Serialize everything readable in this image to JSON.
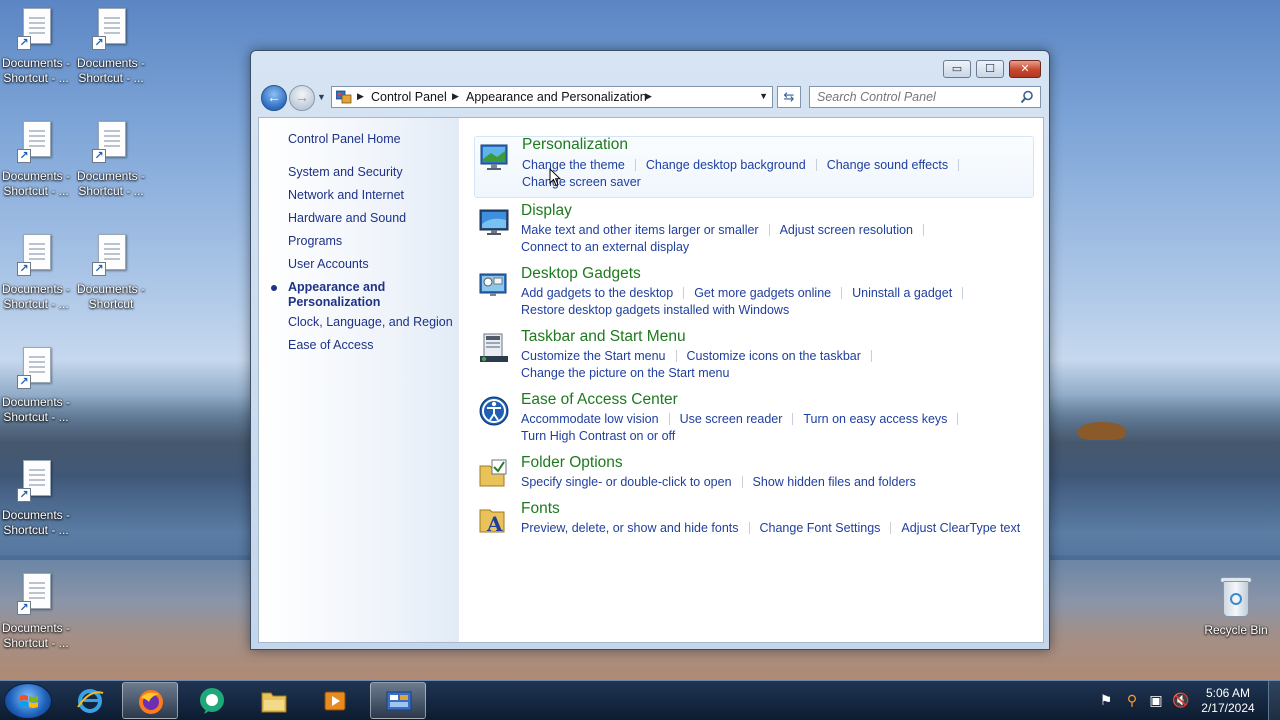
{
  "desktop": {
    "icons": [
      {
        "line1": "Documents -",
        "line2": "Shortcut - ..."
      },
      {
        "line1": "Documents -",
        "line2": "Shortcut - ..."
      },
      {
        "line1": "Documents -",
        "line2": "Shortcut - ..."
      },
      {
        "line1": "Documents -",
        "line2": "Shortcut - ..."
      },
      {
        "line1": "Documents -",
        "line2": "Shortcut - ..."
      },
      {
        "line1": "Documents -",
        "line2": "Shortcut"
      },
      {
        "line1": "Documents -",
        "line2": "Shortcut - ..."
      },
      {
        "line1": "Documents -",
        "line2": "Shortcut - ..."
      },
      {
        "line1": "Documents -",
        "line2": "Shortcut - ..."
      }
    ],
    "recycle_bin": "Recycle Bin"
  },
  "window": {
    "controls": {
      "minimize": "▭",
      "maximize": "☐",
      "close": "✕"
    },
    "breadcrumb": [
      "Control Panel",
      "Appearance and Personalization"
    ],
    "search_placeholder": "Search Control Panel",
    "left_nav": {
      "home": "Control Panel Home",
      "items": [
        "System and Security",
        "Network and Internet",
        "Hardware and Sound",
        "Programs",
        "User Accounts",
        "Appearance and",
        "Personalization",
        "Clock, Language, and Region",
        "Ease of Access"
      ]
    },
    "categories": [
      {
        "title": "Personalization",
        "links": [
          "Change the theme",
          "Change desktop background",
          "Change sound effects",
          "Change screen saver"
        ]
      },
      {
        "title": "Display",
        "links": [
          "Make text and other items larger or smaller",
          "Adjust screen resolution",
          "Connect to an external display"
        ]
      },
      {
        "title": "Desktop Gadgets",
        "links": [
          "Add gadgets to the desktop",
          "Get more gadgets online",
          "Uninstall a gadget",
          "Restore desktop gadgets installed with Windows"
        ]
      },
      {
        "title": "Taskbar and Start Menu",
        "links": [
          "Customize the Start menu",
          "Customize icons on the taskbar",
          "Change the picture on the Start menu"
        ]
      },
      {
        "title": "Ease of Access Center",
        "links": [
          "Accommodate low vision",
          "Use screen reader",
          "Turn on easy access keys",
          "Turn High Contrast on or off"
        ]
      },
      {
        "title": "Folder Options",
        "links": [
          "Specify single- or double-click to open",
          "Show hidden files and folders"
        ]
      },
      {
        "title": "Fonts",
        "links": [
          "Preview, delete, or show and hide fonts",
          "Change Font Settings",
          "Adjust ClearType text"
        ]
      }
    ]
  },
  "taskbar": {
    "time": "5:06 AM",
    "date": "2/17/2024"
  },
  "colors": {
    "link": "#1f3f9e",
    "category_title": "#1e7a1e",
    "nav_text": "#1e3287"
  }
}
